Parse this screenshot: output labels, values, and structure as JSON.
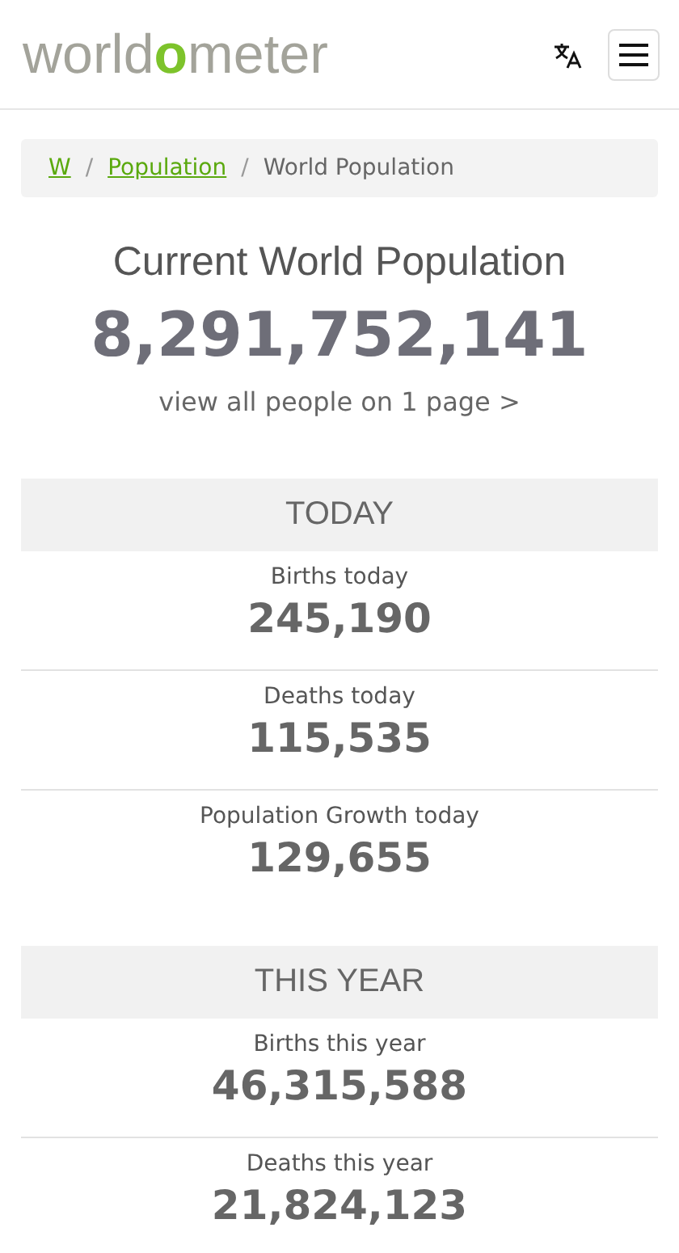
{
  "logo": [
    {
      "text": "world",
      "highlight": false
    },
    {
      "text": "o",
      "highlight": true
    },
    {
      "text": "meter",
      "highlight": false
    }
  ],
  "breadcrumb_separator": "/",
  "breadcrumb": [
    {
      "label": "W",
      "link": true
    },
    {
      "label": "Population",
      "link": true
    },
    {
      "label": "World Population",
      "link": false
    }
  ],
  "title": "Current World Population",
  "counter": "8,291,752,141",
  "view_link": "view all people on 1 page >",
  "sections": [
    {
      "heading": "TODAY",
      "stats": [
        {
          "label": "Births today",
          "value": "245,190"
        },
        {
          "label": "Deaths today",
          "value": "115,535"
        },
        {
          "label": "Population Growth today",
          "value": "129,655"
        }
      ]
    },
    {
      "heading": "THIS YEAR",
      "stats": [
        {
          "label": "Births this year",
          "value": "46,315,588"
        },
        {
          "label": "Deaths this year",
          "value": "21,824,123"
        }
      ]
    }
  ]
}
